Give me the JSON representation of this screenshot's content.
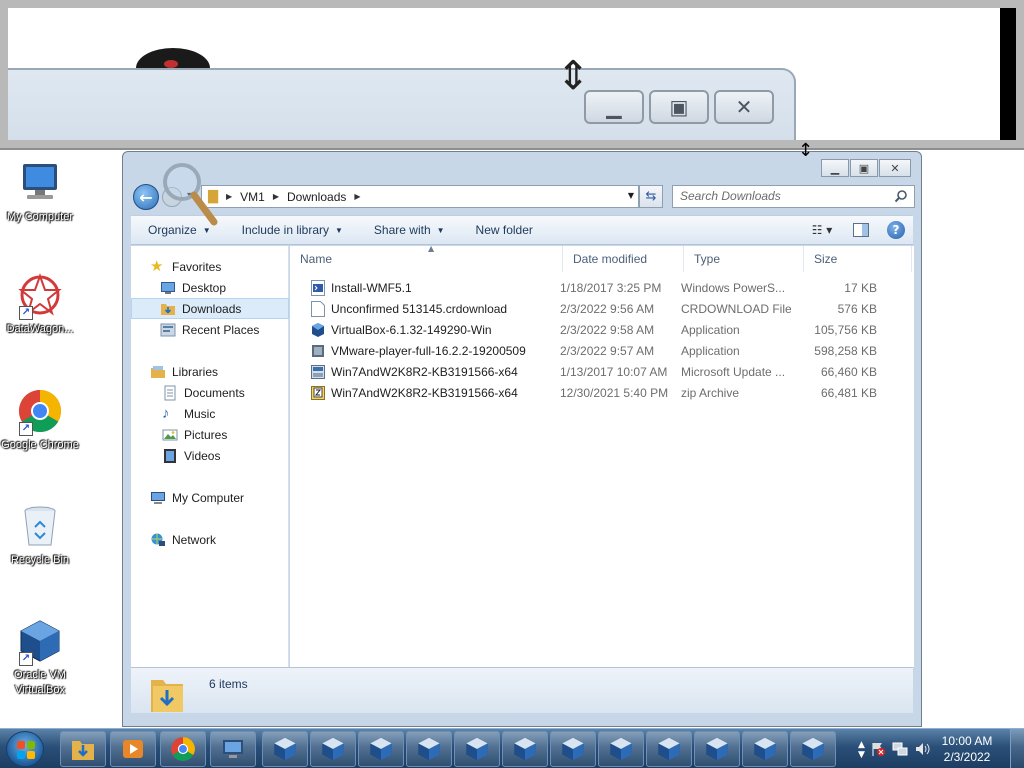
{
  "explorer": {
    "address": {
      "segments": [
        "VM1",
        "Downloads"
      ]
    },
    "search": {
      "placeholder": "Search Downloads"
    },
    "toolbar": {
      "organize": "Organize",
      "include_in_library": "Include in library",
      "share_with": "Share with",
      "new_folder": "New folder"
    },
    "nav": {
      "favorites": "Favorites",
      "desktop": "Desktop",
      "downloads": "Downloads",
      "recent_places": "Recent Places",
      "libraries": "Libraries",
      "documents": "Documents",
      "music": "Music",
      "pictures": "Pictures",
      "videos": "Videos",
      "my_computer": "My Computer",
      "network": "Network"
    },
    "columns": {
      "name": "Name",
      "date": "Date modified",
      "type": "Type",
      "size": "Size"
    },
    "files": [
      {
        "name": "Install-WMF5.1",
        "date": "1/18/2017 3:25 PM",
        "type": "Windows PowerS...",
        "size": "17 KB",
        "icon": "powershell-script-icon"
      },
      {
        "name": "Unconfirmed 513145.crdownload",
        "date": "2/3/2022 9:56 AM",
        "type": "CRDOWNLOAD File",
        "size": "576 KB",
        "icon": "blank-file-icon"
      },
      {
        "name": "VirtualBox-6.1.32-149290-Win",
        "date": "2/3/2022 9:58 AM",
        "type": "Application",
        "size": "105,756 KB",
        "icon": "virtualbox-installer-icon"
      },
      {
        "name": "VMware-player-full-16.2.2-19200509",
        "date": "2/3/2022 9:57 AM",
        "type": "Application",
        "size": "598,258 KB",
        "icon": "vmware-installer-icon"
      },
      {
        "name": "Win7AndW2K8R2-KB3191566-x64",
        "date": "1/13/2017 10:07 AM",
        "type": "Microsoft Update ...",
        "size": "66,460 KB",
        "icon": "msu-update-icon"
      },
      {
        "name": "Win7AndW2K8R2-KB3191566-x64",
        "date": "12/30/2021 5:40 PM",
        "type": "zip Archive",
        "size": "66,481 KB",
        "icon": "zip-archive-icon"
      }
    ],
    "status": {
      "count": "6 items"
    }
  },
  "desktop": {
    "icons": [
      {
        "label": "My Computer"
      },
      {
        "label": "DataWagon..."
      },
      {
        "label": "Google Chrome"
      },
      {
        "label": "Recycle Bin"
      },
      {
        "label": "Oracle VM VirtualBox"
      }
    ]
  },
  "taskbar": {
    "clock_time": "10:00 AM",
    "clock_date": "2/3/2022"
  },
  "colors": {
    "taskbar": "#2a4f78",
    "window_frame": "#c8d7e8",
    "selection": "#dcebfa"
  }
}
